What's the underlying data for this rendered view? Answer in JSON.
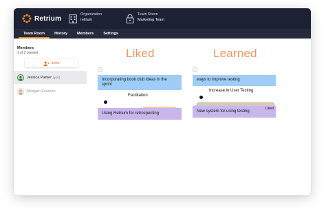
{
  "app": {
    "name": "Retrium",
    "accent": "#f28b2a"
  },
  "context": {
    "organization": {
      "label": "Organization",
      "value": "retrium",
      "icon": "building-icon"
    },
    "team_room": {
      "label": "Team Room",
      "value": "Marketing Team",
      "icon": "lock-icon"
    }
  },
  "nav": {
    "tabs": [
      "Team Room",
      "History",
      "Members",
      "Settings"
    ],
    "active": "Team Room"
  },
  "sidebar": {
    "title": "Members",
    "count": "1 of 2 present",
    "invite_label": "Invite",
    "members": [
      {
        "name": "Jessica Parker",
        "suffix": "(you)",
        "present": true
      },
      {
        "name": "Meagan Everson",
        "suffix": "",
        "present": false
      }
    ]
  },
  "board": {
    "columns": [
      {
        "title": "Liked",
        "cards": [
          {
            "text": "Incorporating book club ideas in the sprint",
            "color": "#9fcdf5"
          },
          {
            "text": "Facilitation",
            "color": "none"
          },
          {
            "text": "Using Retrium for retrospecting",
            "color": "#c9b7ec"
          }
        ]
      },
      {
        "title": "Learned",
        "cards": [
          {
            "text": "ways to improve testing",
            "color": "#9fcdf5"
          },
          {
            "text": "Increase in User Testing",
            "color": "none"
          },
          {
            "text": "New system for using testing",
            "color": "#c9b7ec"
          }
        ],
        "stack_label": "Liked"
      }
    ]
  }
}
